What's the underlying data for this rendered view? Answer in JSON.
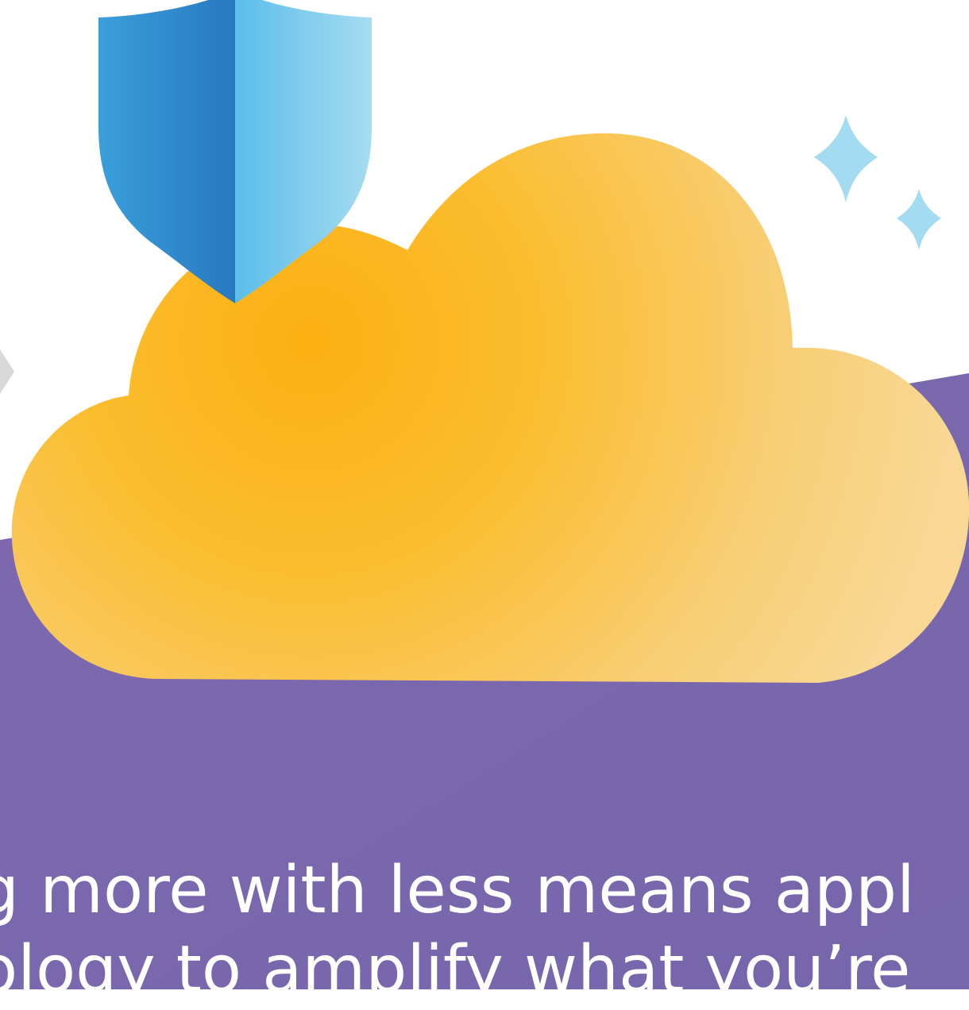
{
  "caption": {
    "line1": "g more with less means appl",
    "line2": "ology to amplify what you’re"
  },
  "colors": {
    "background": "#ffffff",
    "band": "#7b68ad",
    "cloud_core": "#fbb315",
    "cloud_edge": "#f8d58c",
    "shield_dark": "#2b7fc4",
    "shield_light": "#9fdcf0",
    "sparkle": "#a3dcf0",
    "text": "#ffffff"
  },
  "icons": [
    "shield-icon",
    "cloud-icon",
    "sparkle-icon",
    "arrow-icon"
  ]
}
